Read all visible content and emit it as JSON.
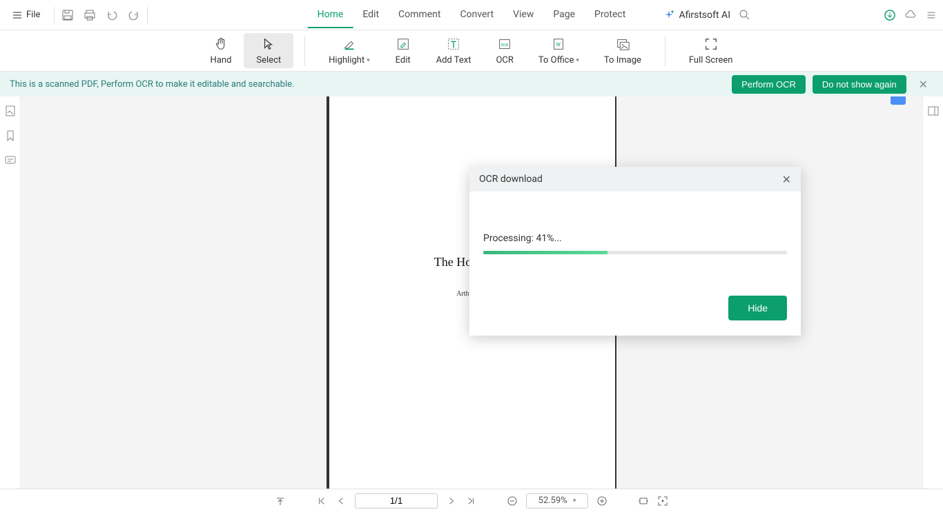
{
  "menu": {
    "file": "File"
  },
  "main_tabs": {
    "home": "Home",
    "edit": "Edit",
    "comment": "Comment",
    "convert": "Convert",
    "view": "View",
    "page": "Page",
    "protect": "Protect"
  },
  "brand": {
    "ai_name": "Afirstsoft AI"
  },
  "toolbar": {
    "hand": "Hand",
    "select": "Select",
    "highlight": "Highlight",
    "edit": "Edit",
    "add_text": "Add Text",
    "ocr": "OCR",
    "to_office": "To Office",
    "to_image": "To Image",
    "full_screen": "Full Screen"
  },
  "banner": {
    "message": "This is a scanned PDF, Perform OCR to make it editable and searchable.",
    "perform_ocr": "Perform OCR",
    "dont_show": "Do not show again"
  },
  "document": {
    "title_visible": "The Hound of t",
    "author_visible": "Arthur Con"
  },
  "modal": {
    "title": "OCR download",
    "status_prefix": "Processing: ",
    "percent": 41,
    "status_suffix": "%...",
    "hide": "Hide"
  },
  "bottom": {
    "page_indicator": "1/1",
    "zoom": "52.59%"
  }
}
